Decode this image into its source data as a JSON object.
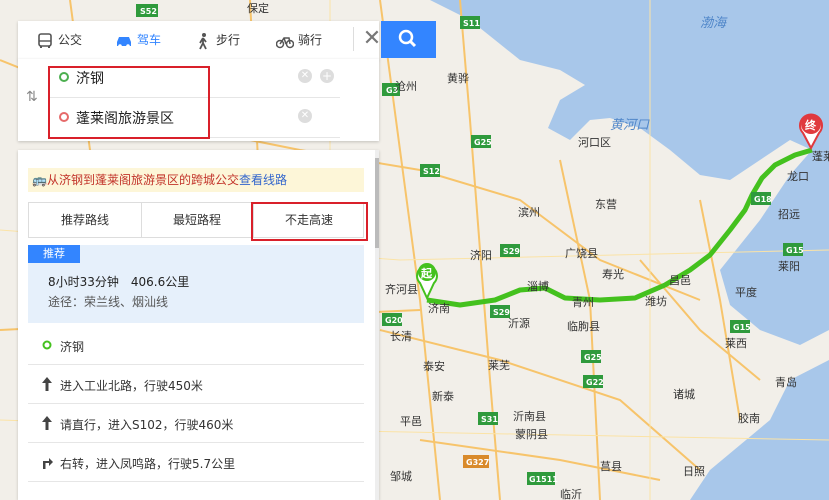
{
  "tabs": [
    {
      "label": "公交",
      "icon": "bus-icon",
      "active": false
    },
    {
      "label": "驾车",
      "icon": "car-icon",
      "active": true
    },
    {
      "label": "步行",
      "icon": "walk-icon",
      "active": false
    },
    {
      "label": "骑行",
      "icon": "bike-icon",
      "active": false
    }
  ],
  "route": {
    "start": "济钢",
    "end": "蓬莱阁旅游景区"
  },
  "notice": {
    "text": "从济钢到蓬莱阁旅游景区的跨城公交",
    "link": "查看线路"
  },
  "strategies": [
    "推荐路线",
    "最短路程",
    "不走高速"
  ],
  "summary": {
    "badge": "推荐",
    "time_distance": "8小时33分钟　406.6公里",
    "via": "途径：荣兰线、烟汕线"
  },
  "steps": [
    {
      "icon": "start-dot-icon",
      "text": "济钢"
    },
    {
      "icon": "arrow-up-icon",
      "text": "进入工业北路，行驶450米"
    },
    {
      "icon": "arrow-up-icon",
      "text": "请直行，进入S102，行驶460米"
    },
    {
      "icon": "turn-right-icon",
      "text": "右转，进入凤鸣路，行驶5.7公里"
    }
  ],
  "map": {
    "markers": {
      "start": "起",
      "end": "终"
    },
    "sea_labels": [
      "渤海",
      "黄河口"
    ],
    "cities": [
      "保定",
      "沧州",
      "黄骅",
      "河口区",
      "东营",
      "滨州",
      "广饶县",
      "淄博",
      "青州",
      "潍坊",
      "临朐县",
      "寿光",
      "昌邑",
      "龙口",
      "招远",
      "平度",
      "莱阳",
      "青岛",
      "诸城",
      "日照",
      "莒县",
      "沂源",
      "泰安",
      "莱芜",
      "蒙阴县",
      "临沂",
      "济阳",
      "齐河县",
      "济南",
      "长清",
      "新泰",
      "邹城",
      "蓬莱",
      "莱西",
      "胶南",
      "沂南县",
      "平邑"
    ],
    "highways": [
      "S52",
      "S11",
      "G3",
      "G25",
      "S12",
      "G18",
      "S29",
      "G15",
      "G20",
      "G22",
      "S31",
      "G1511",
      "G327"
    ],
    "colors": {
      "route": "#44c11e",
      "water": "#a8c7ea",
      "land": "#f2efe9",
      "accent": "#3385ff",
      "highlight": "#d9202a"
    }
  }
}
